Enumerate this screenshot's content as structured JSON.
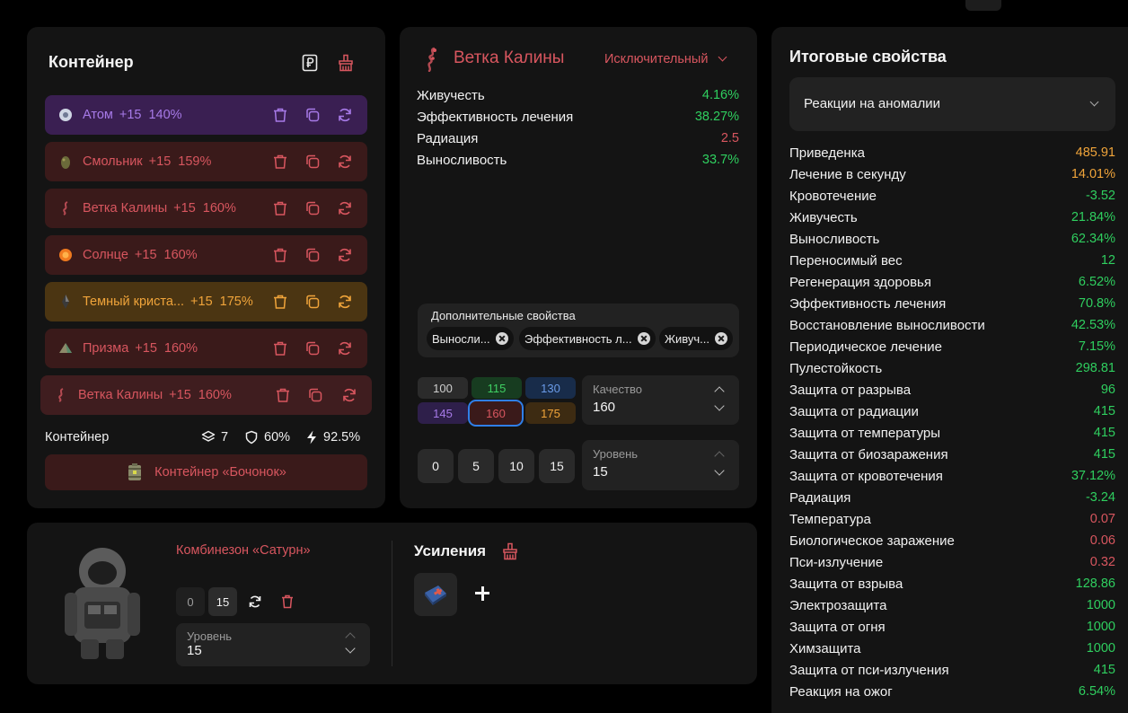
{
  "colors": {
    "accent_red": "#d8565f",
    "positive_green": "#2fcf5f",
    "highlight_orange": "#f0a43a",
    "row_violet": "#3a1f52",
    "row_red": "#3a1a1a",
    "row_gold": "#4b3512",
    "panel_bg": "#141414"
  },
  "container": {
    "title": "Контейнер",
    "icons": [
      "ruble-document-icon",
      "broom-icon"
    ],
    "artifacts": [
      {
        "name": "Атом",
        "level": "+15",
        "percent": "140%",
        "theme": "violet",
        "icon": "atom-artifact-icon"
      },
      {
        "name": "Смольник",
        "level": "+15",
        "percent": "159%",
        "theme": "red",
        "icon": "smolnik-artifact-icon"
      },
      {
        "name": "Ветка Калины",
        "level": "+15",
        "percent": "160%",
        "theme": "red",
        "icon": "viburnum-branch-artifact-icon"
      },
      {
        "name": "Солнце",
        "level": "+15",
        "percent": "160%",
        "theme": "red",
        "icon": "sun-artifact-icon"
      },
      {
        "name": "Темный криста...",
        "level": "+15",
        "percent": "175%",
        "theme": "gold",
        "icon": "dark-crystal-artifact-icon"
      },
      {
        "name": "Призма",
        "level": "+15",
        "percent": "160%",
        "theme": "red",
        "icon": "prism-artifact-icon"
      },
      {
        "name": "Ветка Калины",
        "level": "+15",
        "percent": "160%",
        "theme": "red-active",
        "icon": "viburnum-branch-artifact-icon"
      }
    ],
    "row_actions": [
      "trash-icon",
      "copy-icon",
      "refresh-icon"
    ],
    "footer_label": "Контейнер",
    "slots": "7",
    "protection": "60%",
    "efficiency": "92.5%",
    "footer_icons": [
      "layers-icon",
      "shield-icon",
      "lightning-icon"
    ],
    "container_button": "Контейнер «Бочонок»"
  },
  "detail": {
    "artifact_name": "Ветка Калины",
    "rarity": "Исключительный",
    "properties": [
      {
        "name": "Живучесть",
        "value": "4.16%",
        "tone": "green"
      },
      {
        "name": "Эффективность лечения",
        "value": "38.27%",
        "tone": "green"
      },
      {
        "name": "Радиация",
        "value": "2.5",
        "tone": "red"
      },
      {
        "name": "Выносливость",
        "value": "33.7%",
        "tone": "green"
      }
    ],
    "extra_label": "Дополнительные свойства",
    "extra_chips": [
      "Выносли...",
      "Эффективность л...",
      "Живуч..."
    ],
    "quality_buttons": [
      {
        "label": "100",
        "tone": "gray"
      },
      {
        "label": "115",
        "tone": "green"
      },
      {
        "label": "130",
        "tone": "blue"
      },
      {
        "label": "145",
        "tone": "violet"
      },
      {
        "label": "160",
        "tone": "red",
        "selected": true
      },
      {
        "label": "175",
        "tone": "gold"
      }
    ],
    "quality_label": "Качество",
    "quality_value": "160",
    "level_buttons": [
      "0",
      "5",
      "10",
      "15"
    ],
    "level_label": "Уровень",
    "level_value": "15"
  },
  "suit": {
    "name": "Комбинезон «Сатурн»",
    "level_buttons": [
      "0",
      "15"
    ],
    "level_label": "Уровень",
    "level_value": "15",
    "boosts_title": "Усиления"
  },
  "totals": {
    "title": "Итоговые свойства",
    "dropdown_value": "Реакции на аномалии",
    "rows": [
      {
        "name": "Приведенка",
        "value": "485.91",
        "tone": "orange"
      },
      {
        "name": "Лечение в секунду",
        "value": "14.01%",
        "tone": "orange"
      },
      {
        "name": "Кровотечение",
        "value": "-3.52",
        "tone": "green"
      },
      {
        "name": "Живучесть",
        "value": "21.84%",
        "tone": "green"
      },
      {
        "name": "Выносливость",
        "value": "62.34%",
        "tone": "green"
      },
      {
        "name": "Переносимый вес",
        "value": "12",
        "tone": "green"
      },
      {
        "name": "Регенерация здоровья",
        "value": "6.52%",
        "tone": "green"
      },
      {
        "name": "Эффективность лечения",
        "value": "70.8%",
        "tone": "green"
      },
      {
        "name": "Восстановление выносливости",
        "value": "42.53%",
        "tone": "green"
      },
      {
        "name": "Периодическое лечение",
        "value": "7.15%",
        "tone": "green"
      },
      {
        "name": "Пулестойкость",
        "value": "298.81",
        "tone": "green"
      },
      {
        "name": "Защита от разрыва",
        "value": "96",
        "tone": "green"
      },
      {
        "name": "Защита от радиации",
        "value": "415",
        "tone": "green"
      },
      {
        "name": "Защита от температуры",
        "value": "415",
        "tone": "green"
      },
      {
        "name": "Защита от биозаражения",
        "value": "415",
        "tone": "green"
      },
      {
        "name": "Защита от кровотечения",
        "value": "37.12%",
        "tone": "green"
      },
      {
        "name": "Радиация",
        "value": "-3.24",
        "tone": "green"
      },
      {
        "name": "Температура",
        "value": "0.07",
        "tone": "red"
      },
      {
        "name": "Биологическое заражение",
        "value": "0.06",
        "tone": "red"
      },
      {
        "name": "Пси-излучение",
        "value": "0.32",
        "tone": "red"
      },
      {
        "name": "Защита от взрыва",
        "value": "128.86",
        "tone": "green"
      },
      {
        "name": "Электрозащита",
        "value": "1000",
        "tone": "green"
      },
      {
        "name": "Защита от огня",
        "value": "1000",
        "tone": "green"
      },
      {
        "name": "Химзащита",
        "value": "1000",
        "tone": "green"
      },
      {
        "name": "Защита от пси-излучения",
        "value": "415",
        "tone": "green"
      },
      {
        "name": "Реакция на ожог",
        "value": "6.54%",
        "tone": "green"
      }
    ]
  }
}
